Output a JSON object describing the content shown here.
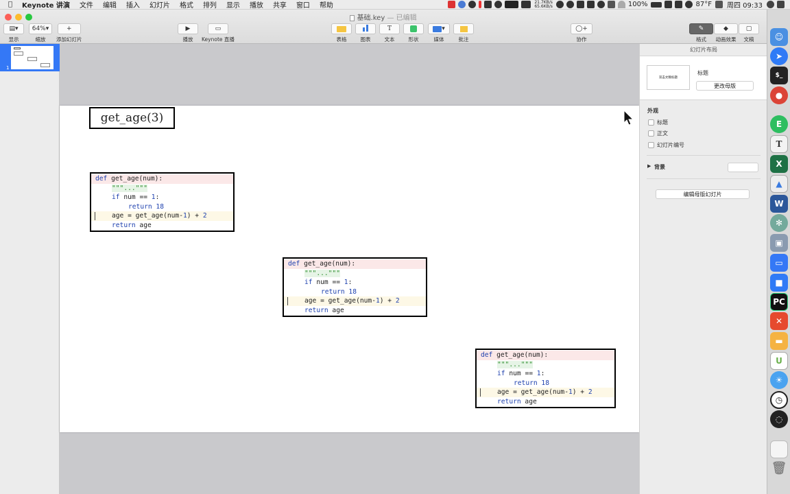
{
  "menubar": {
    "app": "Keynote 讲演",
    "items": [
      "文件",
      "编辑",
      "插入",
      "幻灯片",
      "格式",
      "排列",
      "显示",
      "播放",
      "共享",
      "窗口",
      "帮助"
    ],
    "net_up": "21.7KB/s",
    "net_down": "65.6KB/s",
    "battery": "100%",
    "temp": "87°F",
    "clock": "周四 09:33"
  },
  "window": {
    "title": "基础.key",
    "subtitle": "— 已编辑"
  },
  "toolbar": {
    "view_label": "显示",
    "zoom_value": "64%",
    "zoom_label": "缩放",
    "add_slide_label": "添加幻灯片",
    "play_label": "播放",
    "keynote_live_label": "Keynote 直播",
    "table_label": "表格",
    "chart_label": "图表",
    "text_label": "文本",
    "text_icon": "T",
    "shape_label": "形状",
    "media_label": "媒体",
    "comment_label": "批注",
    "collab_label": "协作",
    "format_label": "格式",
    "animate_label": "动画效果",
    "document_label": "文稿"
  },
  "thumbnails": {
    "slide_number": "1"
  },
  "slide": {
    "title": "get_age(3)",
    "code": {
      "l1_kw": "def",
      "l1_rest": " get_age(num):",
      "l2": "\"\"\"...\"\"\"",
      "l3_kw": "if",
      "l3_mid": " num == ",
      "l3_num": "1",
      "l3_end": ":",
      "l4_kw": "return",
      "l4_num": " 18",
      "l5_a": "age = get_age(num-",
      "l5_n1": "1",
      "l5_b": ") + ",
      "l5_n2": "2",
      "l6_kw": "return",
      "l6_rest": " age"
    }
  },
  "panel": {
    "header": "幻灯片布局",
    "thumb_title": "双击文稿标题",
    "layout_name": "标题",
    "change_master": "更改母版",
    "appearance": "外观",
    "cb_title": "标题",
    "cb_body": "正文",
    "cb_slide_number": "幻灯片编号",
    "background": "背景",
    "edit_master": "编辑母版幻灯片"
  },
  "colors": {
    "accent": "#2f7bf6",
    "selection": "#3478f6"
  },
  "dock": [
    "finder-icon",
    "safari-icon",
    "terminal-icon",
    "chrome-icon",
    "evernote-icon",
    "typora-icon",
    "excel-icon",
    "keynote-icon",
    "word-icon",
    "chatgpt-icon",
    "preview-icon",
    "screensharing-icon",
    "keynote-blue-icon",
    "pycharm-icon",
    "xmind-icon",
    "folder-icon",
    "utorrent-icon",
    "weather-icon",
    "clock-icon",
    "obs-icon",
    "notes-icon",
    "trash-icon"
  ]
}
